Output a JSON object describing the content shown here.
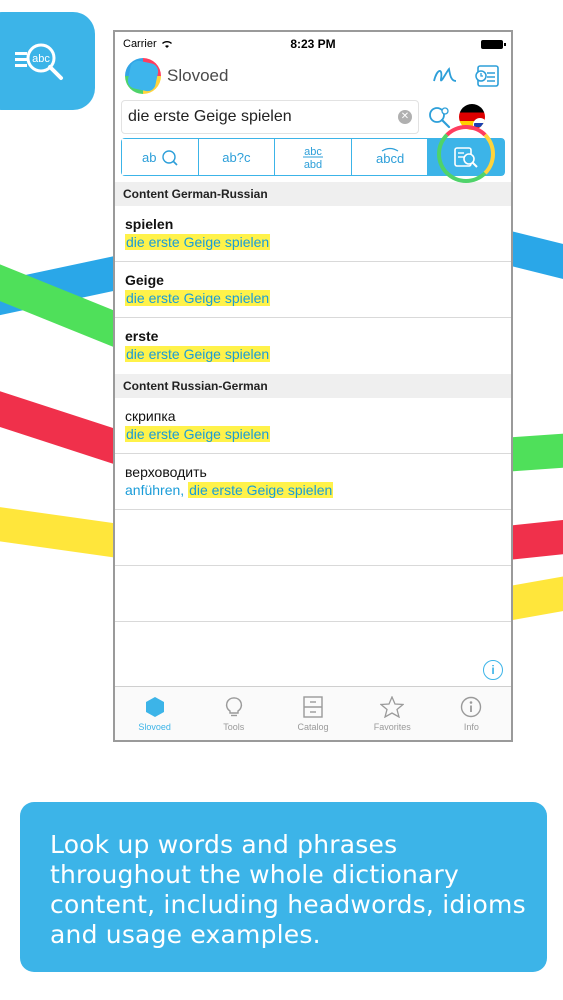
{
  "status_bar": {
    "carrier": "Carrier",
    "time": "8:23 PM"
  },
  "app": {
    "name": "Slovoed"
  },
  "search": {
    "query": "die erste Geige spielen"
  },
  "mode_buttons": [
    {
      "label": "ab"
    },
    {
      "label": "ab?c"
    },
    {
      "label": "abc/abd"
    },
    {
      "label": "abcd"
    },
    {
      "label": "full-text"
    }
  ],
  "sections": [
    {
      "title": "Content German-Russian",
      "entries": [
        {
          "head": "spielen",
          "sub": "die erste Geige spielen"
        },
        {
          "head": "Geige",
          "sub": "die erste Geige spielen"
        },
        {
          "head": "erste",
          "sub": "die erste Geige spielen"
        }
      ]
    },
    {
      "title": "Content Russian-German",
      "entries": [
        {
          "head": "скрипка",
          "sub": "die erste Geige spielen"
        },
        {
          "head": "верховодить",
          "sub_prefix": "anführen,",
          "sub": "die erste Geige spielen"
        }
      ]
    }
  ],
  "tabs": [
    {
      "label": "Slovoed",
      "icon": "slovoed-icon"
    },
    {
      "label": "Tools",
      "icon": "bulb-icon"
    },
    {
      "label": "Catalog",
      "icon": "cabinet-icon"
    },
    {
      "label": "Favorites",
      "icon": "star-icon"
    },
    {
      "label": "Info",
      "icon": "info-icon"
    }
  ],
  "caption": "Look up words and phrases throughout the whole dictionary content, including headwords, idioms and usage examples.",
  "colors": {
    "accent": "#3cb4e8",
    "highlight": "#fff24a",
    "link": "#1a9cd8"
  }
}
